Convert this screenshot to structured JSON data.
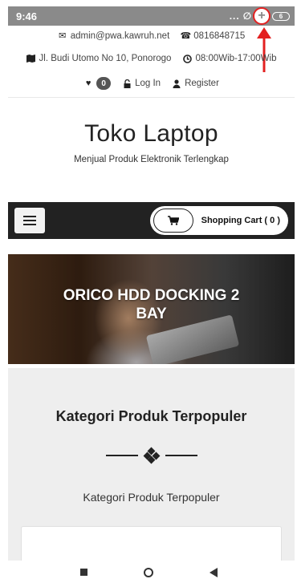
{
  "status_bar": {
    "time": "9:46",
    "dots": "...",
    "battery": "6"
  },
  "contact": {
    "email": "admin@pwa.kawruh.net",
    "phone": "0816848715",
    "address": "Jl. Budi Utomo No 10, Ponorogo",
    "hours": "08:00Wib-17:00Wib"
  },
  "account": {
    "wishlist_count": "0",
    "login_label": "Log In",
    "register_label": "Register"
  },
  "store": {
    "title": "Toko Laptop",
    "subtitle": "Menjual Produk Elektronik Terlengkap"
  },
  "navbar": {
    "cart_label": "Shopping Cart ( 0 )"
  },
  "banner": {
    "title": "ORICO HDD DOCKING 2 BAY"
  },
  "category": {
    "title": "Kategori Produk Terpopuler",
    "subtitle": "Kategori Produk Terpopuler"
  },
  "colors": {
    "accent_red": "#e32020",
    "navbar_bg": "#222222",
    "section_bg": "#eeeeee"
  },
  "icons": [
    "envelope-icon",
    "phone-icon",
    "map-icon",
    "clock-icon",
    "heart-icon",
    "lock-icon",
    "user-icon",
    "menu-icon",
    "cart-icon"
  ]
}
